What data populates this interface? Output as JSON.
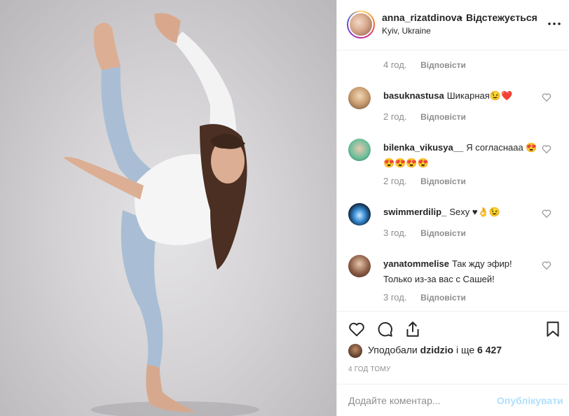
{
  "header": {
    "username": "anna_rizatdinova",
    "separator": "•",
    "follow_label": "Відстежується",
    "location": "Kyiv, Ukraine"
  },
  "comments": {
    "top_meta": {
      "time": "4 год.",
      "reply": "Відповісти"
    },
    "items": [
      {
        "username": "basuknastusa",
        "text": "Шикарная😉❤️",
        "time": "2 год.",
        "reply": "Відповісти"
      },
      {
        "username": "bilenka_vikusya__",
        "text": "Я согласнааа 😍😍😍😍😍",
        "time": "2 год.",
        "reply": "Відповісти"
      },
      {
        "username": "swimmerdilip_",
        "text": "Sexy ♥👌😉",
        "time": "3 год.",
        "reply": "Відповісти"
      },
      {
        "username": "yanatommelise",
        "text": "Так жду эфир! Только из-за вас с Сашей!",
        "time": "3 год.",
        "reply": "Відповісти"
      }
    ]
  },
  "actions": {
    "icons": [
      "heart-icon",
      "comment-icon",
      "share-icon",
      "bookmark-icon"
    ]
  },
  "likes": {
    "prefix": "Уподобали",
    "user": "dzidzio",
    "middle": "і ще",
    "count": "6 427"
  },
  "timestamp": "4 ГОД ТОМУ",
  "add_comment": {
    "placeholder": "Додайте коментар...",
    "post_label": "Опублікувати"
  },
  "colors": {
    "text": "#262626",
    "muted": "#8e8e8e",
    "post_disabled": "#b2dffc",
    "border": "#efefef"
  }
}
